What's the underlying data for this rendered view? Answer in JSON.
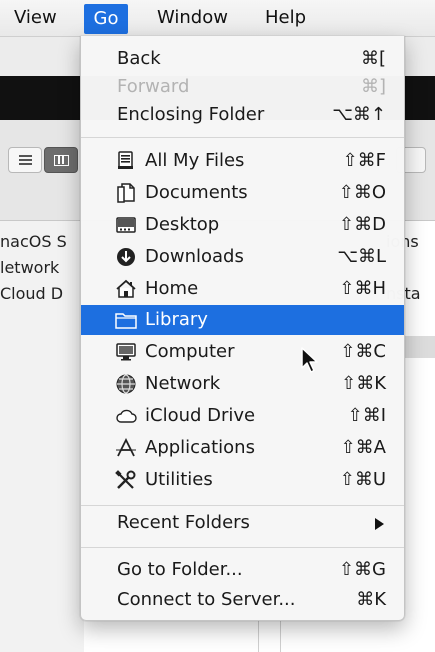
{
  "menubar": {
    "view": "View",
    "go": "Go",
    "window": "Window",
    "help": "Help"
  },
  "background": {
    "sidebar_items": [
      "nacOS S",
      "letwork",
      "Cloud D"
    ],
    "right_texts": [
      "ions",
      "nsta"
    ]
  },
  "go_menu": {
    "section1": [
      {
        "label": "Back",
        "shortcut": "⌘[",
        "enabled": true
      },
      {
        "label": "Forward",
        "shortcut": "⌘]",
        "enabled": false
      },
      {
        "label": "Enclosing Folder",
        "shortcut": "⌥⌘↑",
        "enabled": true
      }
    ],
    "section2": [
      {
        "label": "All My Files",
        "shortcut": "⇧⌘F",
        "icon": "all-my-files-icon"
      },
      {
        "label": "Documents",
        "shortcut": "⇧⌘O",
        "icon": "documents-icon"
      },
      {
        "label": "Desktop",
        "shortcut": "⇧⌘D",
        "icon": "desktop-icon"
      },
      {
        "label": "Downloads",
        "shortcut": "⌥⌘L",
        "icon": "downloads-icon"
      },
      {
        "label": "Home",
        "shortcut": "⇧⌘H",
        "icon": "home-icon"
      },
      {
        "label": "Library",
        "shortcut": "",
        "icon": "library-folder-icon",
        "highlighted": true
      },
      {
        "label": "Computer",
        "shortcut": "⇧⌘C",
        "icon": "computer-icon"
      },
      {
        "label": "Network",
        "shortcut": "⇧⌘K",
        "icon": "network-icon"
      },
      {
        "label": "iCloud Drive",
        "shortcut": "⇧⌘I",
        "icon": "icloud-icon"
      },
      {
        "label": "Applications",
        "shortcut": "⇧⌘A",
        "icon": "applications-icon"
      },
      {
        "label": "Utilities",
        "shortcut": "⇧⌘U",
        "icon": "utilities-icon"
      }
    ],
    "section3": [
      {
        "label": "Recent Folders",
        "submenu": true
      }
    ],
    "section4": [
      {
        "label": "Go to Folder...",
        "shortcut": "⇧⌘G"
      },
      {
        "label": "Connect to Server...",
        "shortcut": "⌘K"
      }
    ]
  },
  "colors": {
    "highlight": "#1d6fe0",
    "disabled_text": "#b3b3b3",
    "menu_bg": "#f6f6f6"
  }
}
